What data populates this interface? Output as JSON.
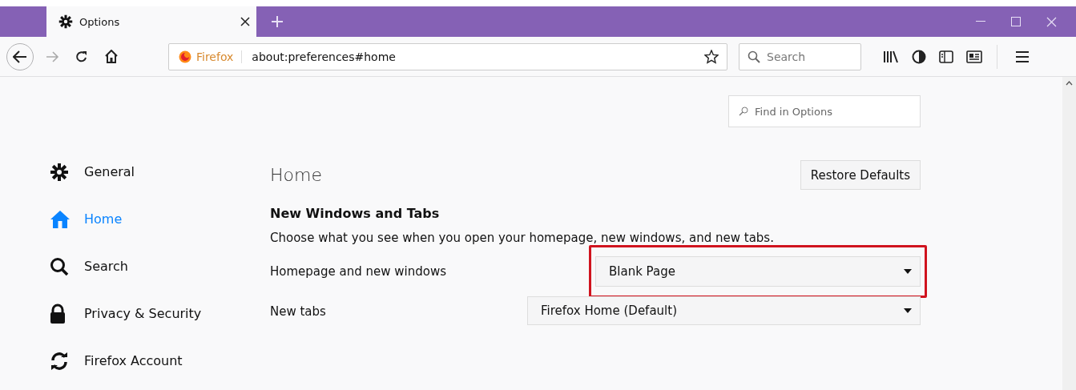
{
  "tabs": [
    {
      "label": "Options",
      "selected": true
    }
  ],
  "toolbar": {
    "identity_label": "Firefox",
    "url": "about:preferences#home",
    "search": {
      "placeholder": "Search"
    }
  },
  "find": {
    "placeholder": "Find in Options"
  },
  "sidebar": {
    "items": [
      {
        "label": "General",
        "selected": false
      },
      {
        "label": "Home",
        "selected": true
      },
      {
        "label": "Search",
        "selected": false
      },
      {
        "label": "Privacy & Security",
        "selected": false
      },
      {
        "label": "Firefox Account",
        "selected": false
      }
    ]
  },
  "page": {
    "title": "Home",
    "restore_button": "Restore Defaults",
    "section_title": "New Windows and Tabs",
    "description": "Choose what you see when you open your homepage, new windows, and new tabs.",
    "settings": [
      {
        "label": "Homepage and new windows",
        "value": "Blank Page",
        "highlighted": true
      },
      {
        "label": "New tabs",
        "value": "Firefox Home (Default)",
        "highlighted": false
      }
    ]
  }
}
